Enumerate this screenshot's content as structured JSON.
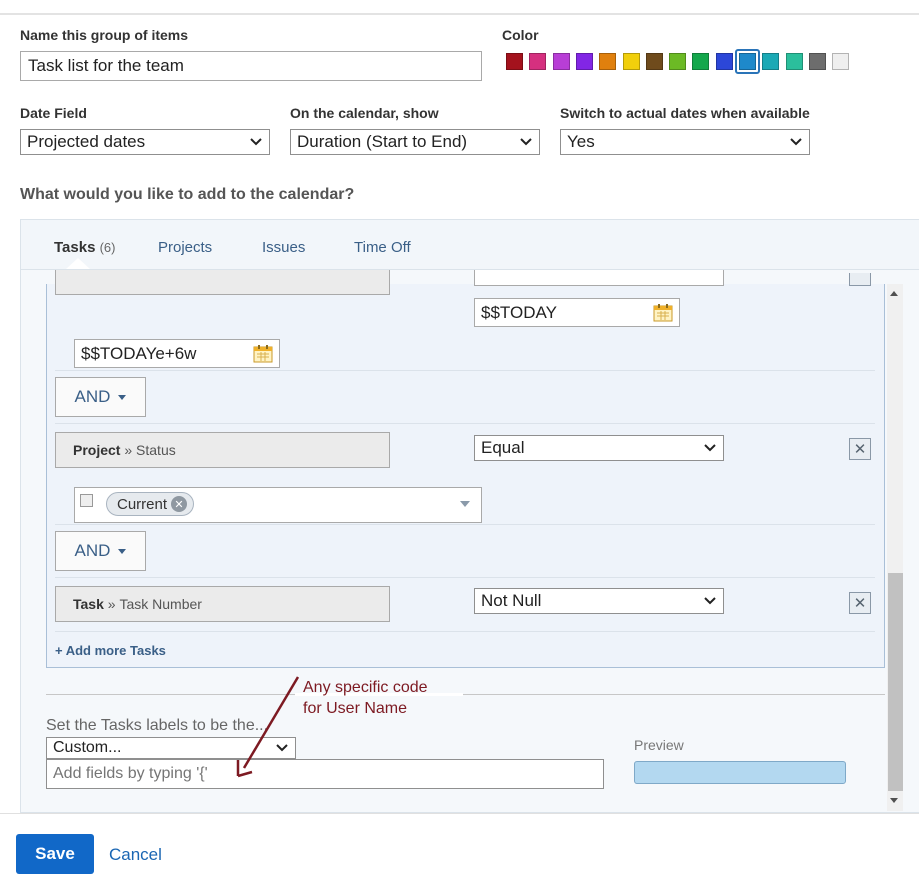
{
  "group_name": {
    "label": "Name this group of items",
    "value": "Task list for the team"
  },
  "color": {
    "label": "Color",
    "swatches": [
      "#a4121d",
      "#d5307f",
      "#b83ed6",
      "#8226e5",
      "#e0800e",
      "#f1cf0c",
      "#6f4b1c",
      "#6cba25",
      "#14a74c",
      "#2c47d8",
      "#1e89ca",
      "#1ba9b5",
      "#2bbf9c",
      "#6d6d6d",
      "#efefef"
    ],
    "selected_index": 10
  },
  "date_field": {
    "label": "Date Field",
    "value": "Projected dates"
  },
  "calendar_show": {
    "label": "On the calendar, show",
    "value": "Duration (Start to End)"
  },
  "actual_dates": {
    "label": "Switch to actual dates when available",
    "value": "Yes"
  },
  "add_question": "What would you like to add to the calendar?",
  "tabs": [
    {
      "label": "Tasks",
      "count": "(6)",
      "active": true
    },
    {
      "label": "Projects"
    },
    {
      "label": "Issues"
    },
    {
      "label": "Time Off"
    }
  ],
  "filters": {
    "date_start_value": "$$TODAY",
    "date_end_value": "$$TODAYe+6w",
    "and_label": "AND",
    "rule_status": {
      "object": "Project",
      "separator": "»",
      "field": "Status",
      "operator": "Equal",
      "tag": "Current"
    },
    "rule_number": {
      "object": "Task",
      "separator": "»",
      "field": "Task Number",
      "operator": "Not Null"
    },
    "add_more": "+ Add more Tasks"
  },
  "labels_section": {
    "label": "Set the Tasks labels to be the...",
    "select_value": "Custom...",
    "input_placeholder": "Add fields by typing '{'",
    "preview_label": "Preview"
  },
  "annotation": "Any specific code\nfor User Name",
  "footer": {
    "save": "Save",
    "cancel": "Cancel"
  },
  "colors": {
    "accent": "#1168c8",
    "link": "#3a5f87",
    "annotation": "#7d1a22"
  }
}
